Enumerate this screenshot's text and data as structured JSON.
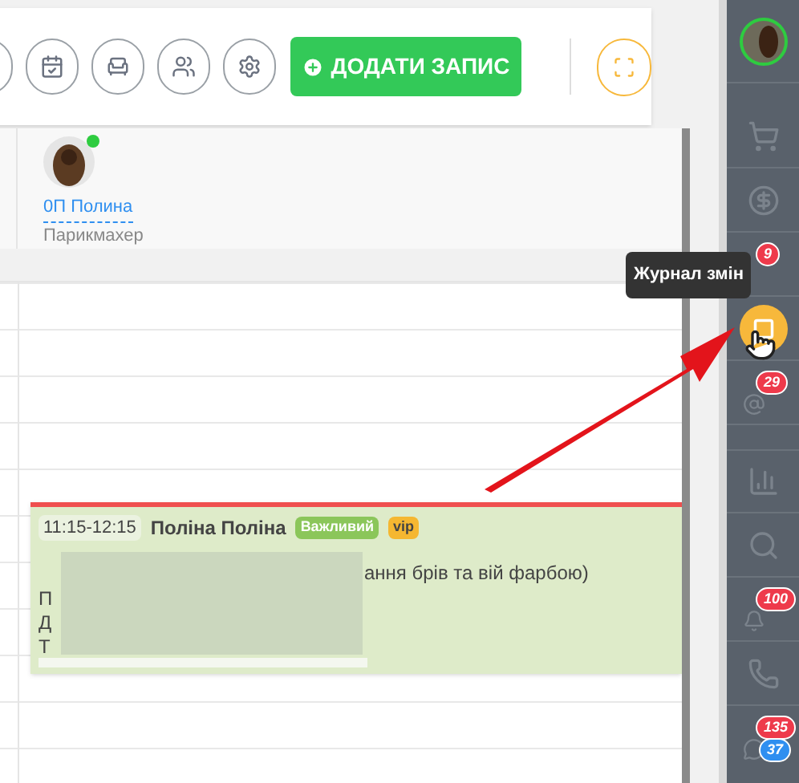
{
  "toolbar": {
    "add_button": "ДОДАТИ ЗАПИС"
  },
  "staff": [
    {
      "name": "0П Полина",
      "role": "Парикмахер",
      "online": true
    }
  ],
  "appointment": {
    "time": "11:15-12:15",
    "client": "Поліна Поліна",
    "tags": [
      {
        "label": "Важливий",
        "color": "#8bc65a"
      },
      {
        "label": "vip",
        "color": "#f5b731"
      }
    ],
    "service_tail": "ання брів та вій фарбою)",
    "line_starts": [
      "П",
      "Д",
      "Т"
    ]
  },
  "tooltip": "Журнал змін",
  "sidebar": [
    {
      "kind": "cart",
      "selected": false
    },
    {
      "kind": "money",
      "selected": false
    },
    {
      "kind": "covered",
      "selected": false,
      "badge": "9"
    },
    {
      "kind": "journal",
      "selected": true
    },
    {
      "kind": "mail",
      "selected": false,
      "badge": "29"
    },
    {
      "kind": "stats",
      "selected": false,
      "divider_before": true
    },
    {
      "kind": "search",
      "selected": false
    },
    {
      "kind": "bell",
      "selected": false,
      "badge": "100"
    },
    {
      "kind": "phone",
      "selected": false
    },
    {
      "kind": "chat",
      "selected": false,
      "badge": "135",
      "badge2": "37"
    }
  ]
}
